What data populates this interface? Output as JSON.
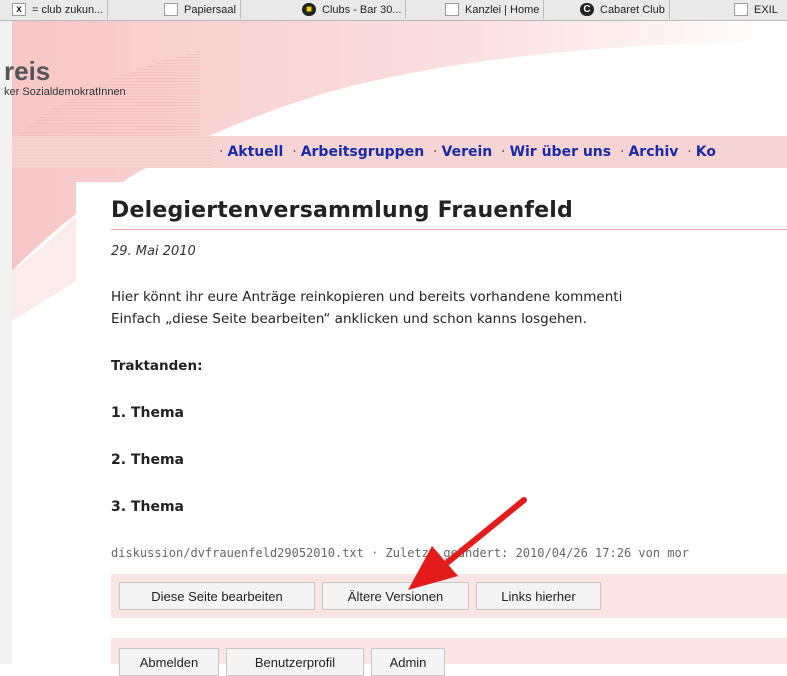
{
  "bookmarks": [
    {
      "label": "= club zukun...",
      "icon": "club-icon"
    },
    {
      "label": "Papiersaal",
      "icon": "page-icon"
    },
    {
      "label": "Clubs - Bar 30...",
      "icon": "lion-icon"
    },
    {
      "label": "Kanzlei | Home",
      "icon": "page-icon"
    },
    {
      "label": "Cabaret Club",
      "icon": "c-icon"
    },
    {
      "label": "EXIL",
      "icon": "page-icon"
    }
  ],
  "site": {
    "title": "reis",
    "subtitle": "ker SozialdemokratInnen"
  },
  "nav": {
    "items": [
      "Aktuell",
      "Arbeitsgruppen",
      "Verein",
      "Wir über uns",
      "Archiv",
      "Ko"
    ],
    "separator": "·"
  },
  "page": {
    "title": "Delegiertenversammlung Frauenfeld",
    "date": "29. Mai 2010",
    "intro_line1": "Hier könnt ihr eure Anträge reinkopieren und bereits vorhandene kommenti",
    "intro_line2": "Einfach „diese Seite bearbeiten“ anklicken und schon kanns losgehen.",
    "traktanden": "Traktanden:",
    "themes": [
      "1. Thema",
      "2. Thema",
      "3. Thema"
    ],
    "meta": "diskussion/dvfrauenfeld29052010.txt · Zuletzt geändert: 2010/04/26 17:26 von mor"
  },
  "buttons": {
    "edit": "Diese Seite bearbeiten",
    "revisions": "Ältere Versionen",
    "backlinks": "Links hierher",
    "logout": "Abmelden",
    "profile": "Benutzerprofil",
    "admin": "Admin"
  },
  "colors": {
    "accent_pink": "#f7d4d4",
    "nav_link": "#1a2aa8",
    "arrow_red": "#e31b1b"
  }
}
